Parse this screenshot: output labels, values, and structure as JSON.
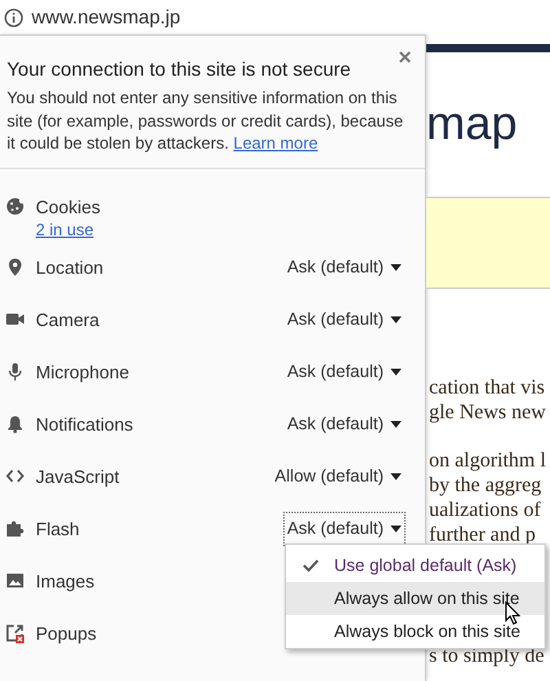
{
  "address_bar": {
    "url": "www.newsmap.jp"
  },
  "site_info": {
    "title": "Your connection to this site is not secure",
    "message": "You should not enter any sensitive information on this site (for example, passwords or credit cards), because it could be stolen by attackers.",
    "learn_more": "Learn more",
    "permissions": [
      {
        "kind": "cookies",
        "label": "Cookies",
        "detail": "2 in use"
      },
      {
        "kind": "location",
        "label": "Location",
        "value": "Ask (default)",
        "focused": false
      },
      {
        "kind": "camera",
        "label": "Camera",
        "value": "Ask (default)",
        "focused": false
      },
      {
        "kind": "microphone",
        "label": "Microphone",
        "value": "Ask (default)",
        "focused": false
      },
      {
        "kind": "notifications",
        "label": "Notifications",
        "value": "Ask (default)",
        "focused": false
      },
      {
        "kind": "javascript",
        "label": "JavaScript",
        "value": "Allow (default)",
        "focused": false
      },
      {
        "kind": "flash",
        "label": "Flash",
        "value": "Ask (default)",
        "focused": true
      },
      {
        "kind": "images",
        "label": "Images"
      },
      {
        "kind": "popups",
        "label": "Popups"
      }
    ]
  },
  "dropdown_menu": {
    "items": [
      {
        "label": "Use global default (Ask)",
        "checked": true,
        "selected": false
      },
      {
        "label": "Always allow on this site",
        "checked": false,
        "selected": true
      },
      {
        "label": "Always block on this site",
        "checked": false,
        "selected": false
      }
    ]
  },
  "background_page": {
    "logo_fragment": "map",
    "paragraphs": [
      [
        "cation that vis",
        "gle News new"
      ],
      [
        "on algorithm l",
        "by the aggreg",
        "ualizations of",
        "further and p"
      ],
      [
        "s to simply de"
      ]
    ]
  }
}
